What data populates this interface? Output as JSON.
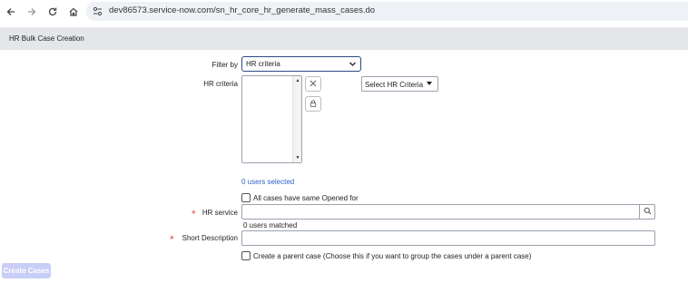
{
  "browser": {
    "url": "dev86573.service-now.com/sn_hr_core_hr_generate_mass_cases.do"
  },
  "page": {
    "title": "HR Bulk Case Creation"
  },
  "form": {
    "filter_by_label": "Filter by",
    "filter_by_value": "HR criteria",
    "hr_criteria_label": "HR criteria",
    "select_criteria_label": "Select HR Criteria",
    "users_selected": "0 users selected",
    "same_opened_for_label": "All cases have same Opened for",
    "hr_service_label": "HR service",
    "hr_service_value": "",
    "users_matched": "0 users matched",
    "short_description_label": "Short Description",
    "short_description_value": "",
    "parent_case_label": "Create a parent case (Choose this if you want to group the cases under a parent case)",
    "required_mark": "*",
    "create_button": "Create Cases"
  },
  "colors": {
    "link": "#2e63c7",
    "required": "#d9534f",
    "focus_border": "#2b4a86",
    "disabled_button": "#c9cef8",
    "title_band": "#e4e6e9"
  }
}
